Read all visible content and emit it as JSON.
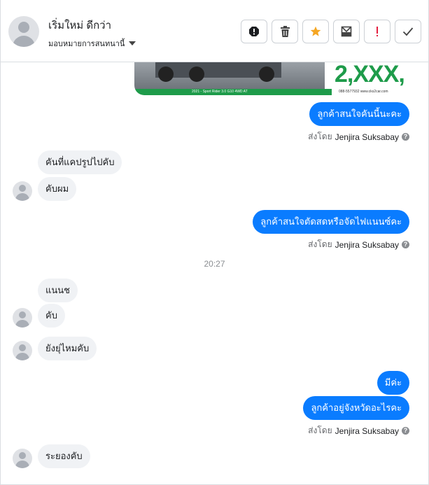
{
  "header": {
    "contact_name": "เริ่มใหม่ ดีกว่า",
    "assign_label": "มอบหมายการสนทนานี้",
    "actions": [
      {
        "name": "report-spam-icon",
        "tooltip": ""
      },
      {
        "name": "trash-icon",
        "tooltip": ""
      },
      {
        "name": "star-icon",
        "color": "#f5a623"
      },
      {
        "name": "mark-unread-icon"
      },
      {
        "name": "important-icon",
        "color": "#e41e3f"
      },
      {
        "name": "check-icon"
      }
    ]
  },
  "ad": {
    "price_text": "2,XXX,",
    "bar_text": "2021 - Sport Rider 3.0 G10 4WD AT",
    "phone_text": "088-5577932   www.cks2car.com"
  },
  "messages": [
    {
      "dir": "out",
      "text": "ลูกค้าสนใจคันนี้นะคะ"
    },
    {
      "dir": "in",
      "text": "คันที่แคปรูปไปคับ"
    },
    {
      "dir": "in",
      "text": "คับผม"
    },
    {
      "dir": "out",
      "text": "ลูกค้าสนใจตัดสดหรือจัดไฟแนนซ์คะ"
    },
    {
      "dir": "in",
      "text": "แนนช"
    },
    {
      "dir": "in",
      "text": "คับ"
    },
    {
      "dir": "in",
      "text": "ยังยุ่ไหมคับ"
    },
    {
      "dir": "out",
      "text": "มีค่ะ"
    },
    {
      "dir": "out",
      "text": "ลูกค้าอยู่จังหวัดอะไรคะ"
    },
    {
      "dir": "in",
      "text": "ระยองคับ"
    }
  ],
  "sent_by": {
    "prefix": "ส่งโดย",
    "name": "Jenjira Suksabay",
    "help": "?"
  },
  "timestamp": "20:27",
  "colors": {
    "outgoing_bubble": "#0a7cff",
    "incoming_bubble": "#f0f2f5",
    "ad_green": "#1e9b4a"
  }
}
